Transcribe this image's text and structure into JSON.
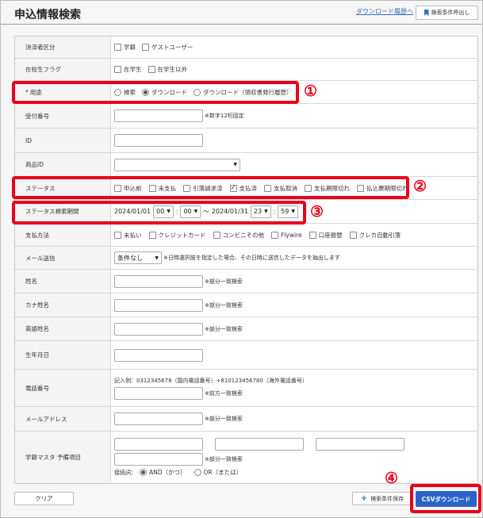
{
  "header": {
    "title": "申込情報検索",
    "history_link": "ダウンロード履歴へ",
    "recall_button": "検索条件呼出し"
  },
  "form": {
    "payer": {
      "label": "決済者区分",
      "options": [
        "学籍",
        "ゲストユーザー"
      ]
    },
    "enrolled": {
      "label": "在校生フラグ",
      "options": [
        "在学生",
        "在学生以外"
      ]
    },
    "purpose": {
      "label": "用途",
      "required_mark": "*",
      "options": [
        "検索",
        "ダウンロード",
        "ダウンロード（領収書発行履歴）"
      ],
      "selected": "ダウンロード"
    },
    "receipt_no": {
      "label": "受付番号",
      "note": "※数字12桁固定"
    },
    "id": {
      "label": "ID"
    },
    "product_id": {
      "label": "商品ID"
    },
    "status": {
      "label": "ステータス",
      "options": [
        "申込前",
        "未支払",
        "引落請求済",
        "支払済",
        "支払取消",
        "支払期限切れ",
        "払込票期限切れ"
      ],
      "checked": "支払済"
    },
    "period": {
      "label": "ステータス検索期間",
      "from_date": "2024/01/01",
      "from_hour": "00",
      "from_min": "00",
      "tilde": "～",
      "to_date": "2024/01/31",
      "to_hour": "23",
      "to_min": "59",
      "colon": ":"
    },
    "payment": {
      "label": "支払方法",
      "options": [
        "未払い",
        "クレジットカード",
        "コンビニその他",
        "Flywire",
        "口座振替",
        "クレカ自動引落"
      ]
    },
    "mail": {
      "label": "メール送信",
      "select": "条件なし",
      "note": "※日時選択肢を指定した場合、その日時に送信したデータを抽出します"
    },
    "name": {
      "label": "姓名",
      "note": "※部分一致検索"
    },
    "kana": {
      "label": "カナ姓名",
      "note": "※部分一致検索"
    },
    "english": {
      "label": "英語姓名",
      "note": "※部分一致検索"
    },
    "birth": {
      "label": "生年月日"
    },
    "phone": {
      "label": "電話番号",
      "example": "記入例：0312345678（国内電話番号）+810123456780（海外電話番号）",
      "note": "※前方一致検索"
    },
    "email": {
      "label": "メールアドレス",
      "note": "※部分一致検索"
    },
    "reserve": {
      "label": "学籍マスタ 予備項目",
      "note": "※部分一致検索",
      "conj_label": "接続詞：",
      "and": "AND（かつ）",
      "or": "OR（または）"
    }
  },
  "footer": {
    "clear": "クリア",
    "save": "検索条件保存",
    "csv": "CSVダウンロード"
  },
  "markers": [
    "①",
    "②",
    "③",
    "④"
  ],
  "colors": {
    "highlight": "#e8001c",
    "primary": "#2a63c8",
    "link": "#3a6fb5"
  }
}
